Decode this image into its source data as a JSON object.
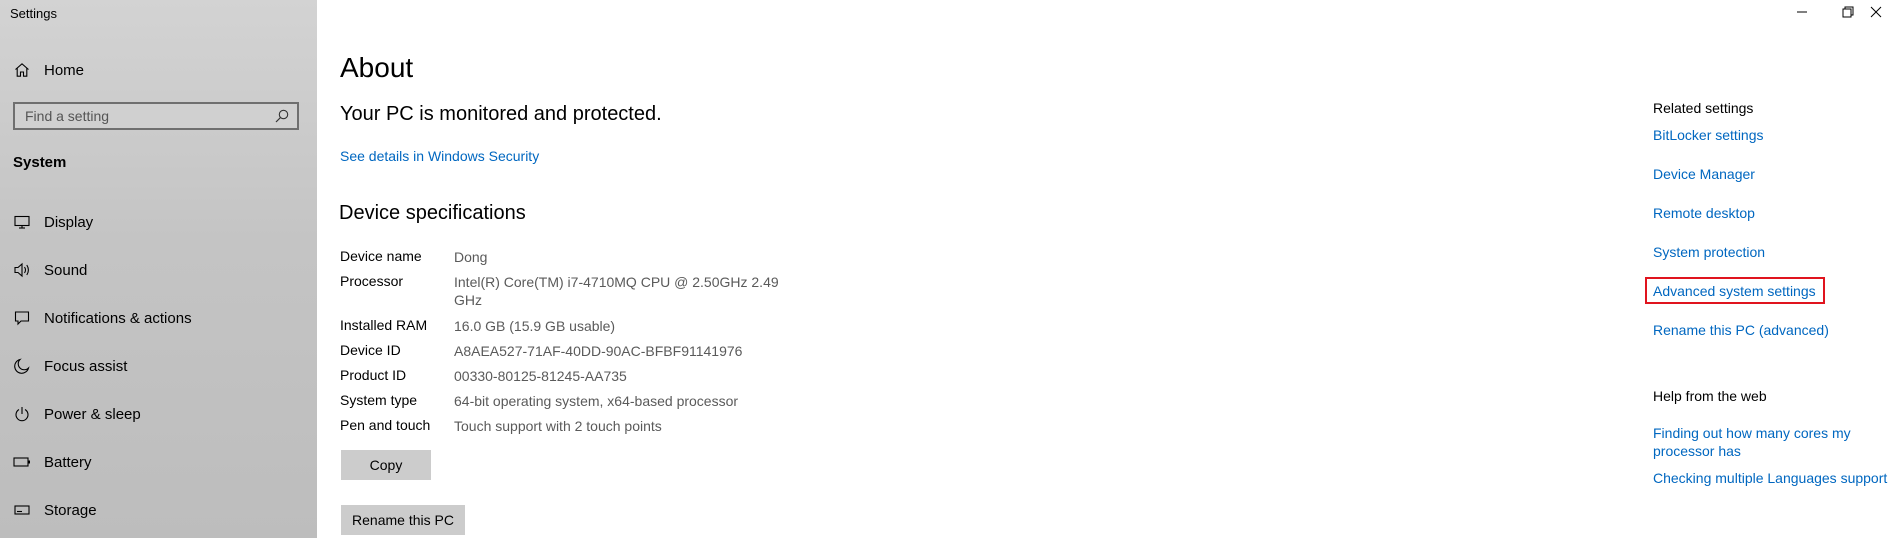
{
  "window": {
    "title": "Settings"
  },
  "sidebar": {
    "home_label": "Home",
    "search_placeholder": "Find a setting",
    "section_label": "System",
    "items": [
      {
        "label": "Display",
        "icon": "display-icon"
      },
      {
        "label": "Sound",
        "icon": "speaker-icon"
      },
      {
        "label": "Notifications & actions",
        "icon": "notification-icon"
      },
      {
        "label": "Focus assist",
        "icon": "moon-icon"
      },
      {
        "label": "Power & sleep",
        "icon": "power-icon"
      },
      {
        "label": "Battery",
        "icon": "battery-icon"
      },
      {
        "label": "Storage",
        "icon": "storage-icon"
      }
    ]
  },
  "main": {
    "title": "About",
    "protection_message": "Your PC is monitored and protected.",
    "security_link": "See details in Windows Security",
    "specs_heading": "Device specifications",
    "specs": [
      {
        "key": "Device name",
        "value": "Dong"
      },
      {
        "key": "Processor",
        "value": "Intel(R) Core(TM) i7-4710MQ CPU @ 2.50GHz   2.49 GHz"
      },
      {
        "key": "Installed RAM",
        "value": "16.0 GB (15.9 GB usable)"
      },
      {
        "key": "Device ID",
        "value": "A8AEA527-71AF-40DD-90AC-BFBF91141976"
      },
      {
        "key": "Product ID",
        "value": "00330-80125-81245-AA735"
      },
      {
        "key": "System type",
        "value": "64-bit operating system, x64-based processor"
      },
      {
        "key": "Pen and touch",
        "value": "Touch support with 2 touch points"
      }
    ],
    "copy_button": "Copy",
    "rename_button": "Rename this PC"
  },
  "related": {
    "heading": "Related settings",
    "links": [
      "BitLocker settings",
      "Device Manager",
      "Remote desktop",
      "System protection",
      "Advanced system settings",
      "Rename this PC (advanced)"
    ],
    "highlighted_link": "Advanced system settings",
    "highlight_color": "#e0141e"
  },
  "help": {
    "heading": "Help from the web",
    "links": [
      "Finding out how many cores my processor has",
      "Checking multiple Languages support"
    ]
  },
  "colors": {
    "link": "#0067c0",
    "sidebar_bg": "#c8c8c8",
    "button_bg": "#cccccc"
  }
}
